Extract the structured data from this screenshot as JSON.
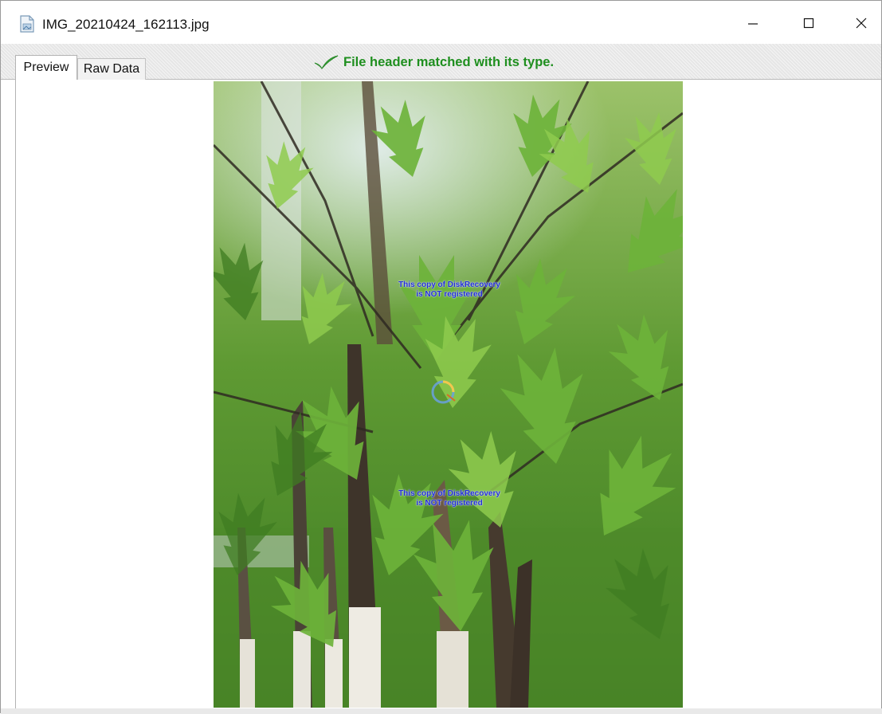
{
  "window": {
    "title": "IMG_20210424_162113.jpg",
    "app_icon": "document-image-icon",
    "controls": {
      "minimize": "minimize-icon",
      "maximize": "maximize-icon",
      "close": "close-icon"
    }
  },
  "tabs": [
    {
      "label": "Preview",
      "active": true
    },
    {
      "label": "Raw Data",
      "active": false
    }
  ],
  "status": {
    "icon": "checkmark-icon",
    "text": "File header matched with its type.",
    "color": "#1f8f1f"
  },
  "preview": {
    "watermarks": [
      {
        "line1": "This copy of DiskRecovery",
        "line2": "is NOT registered"
      },
      {
        "line1": "This copy of DiskRecovery",
        "line2": "is NOT registered"
      }
    ],
    "watermark_color": "#2430d6"
  }
}
